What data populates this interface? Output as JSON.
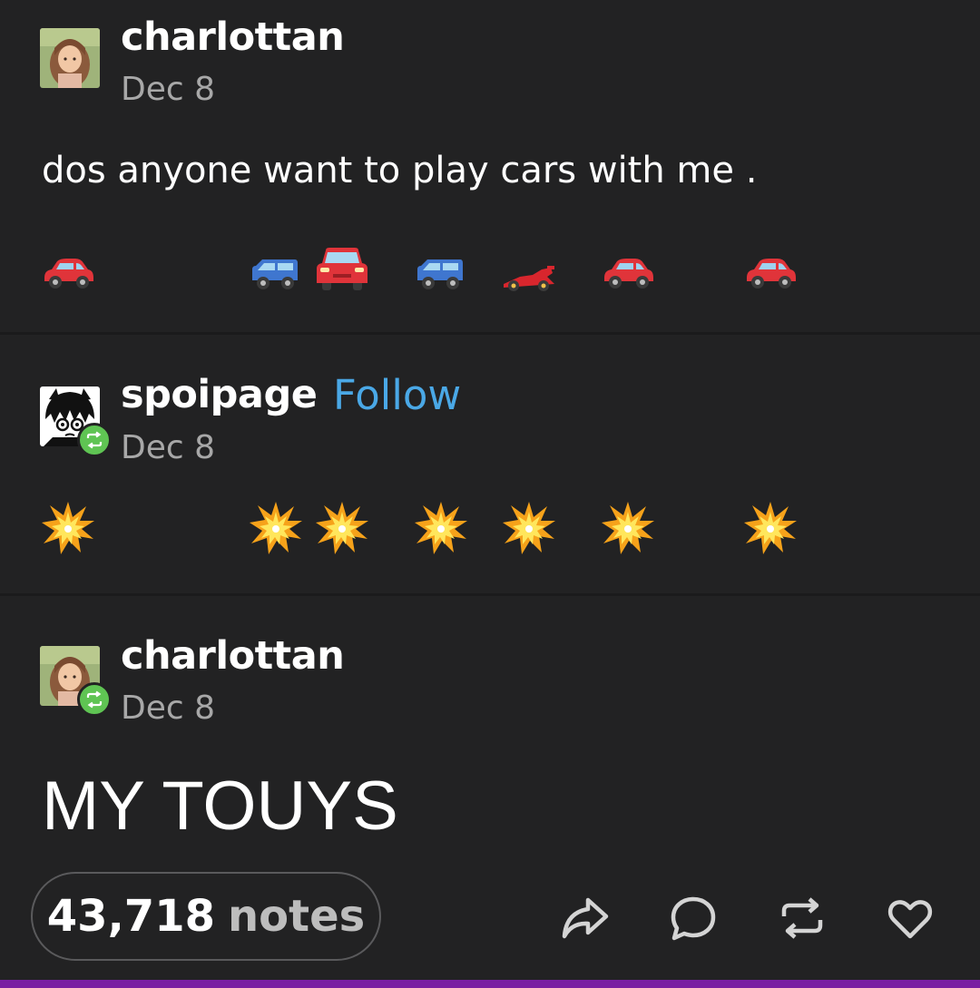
{
  "posts": [
    {
      "username": "charlottan",
      "date": "Dec 8",
      "text": "dos anyone want to play cars with me .",
      "emojis": [
        "red-car",
        "blue-suv",
        "red-car-front",
        "blue-suv",
        "racing-car",
        "red-car",
        "red-car"
      ]
    },
    {
      "username": "spoipage",
      "follow_label": "Follow",
      "date": "Dec 8",
      "emojis": [
        "collision",
        "collision",
        "collision",
        "collision",
        "collision",
        "collision",
        "collision"
      ]
    },
    {
      "username": "charlottan",
      "date": "Dec 8",
      "text": "MY TOUYS"
    }
  ],
  "footer": {
    "notes_count": "43,718",
    "notes_label": "notes",
    "actions": [
      "share-icon",
      "comment-icon",
      "reblog-icon",
      "heart-icon"
    ]
  },
  "colors": {
    "background": "#222223",
    "follow": "#4aa8e6",
    "reblog_badge": "#5fc453",
    "bottom_bar": "#7a1fa2"
  }
}
